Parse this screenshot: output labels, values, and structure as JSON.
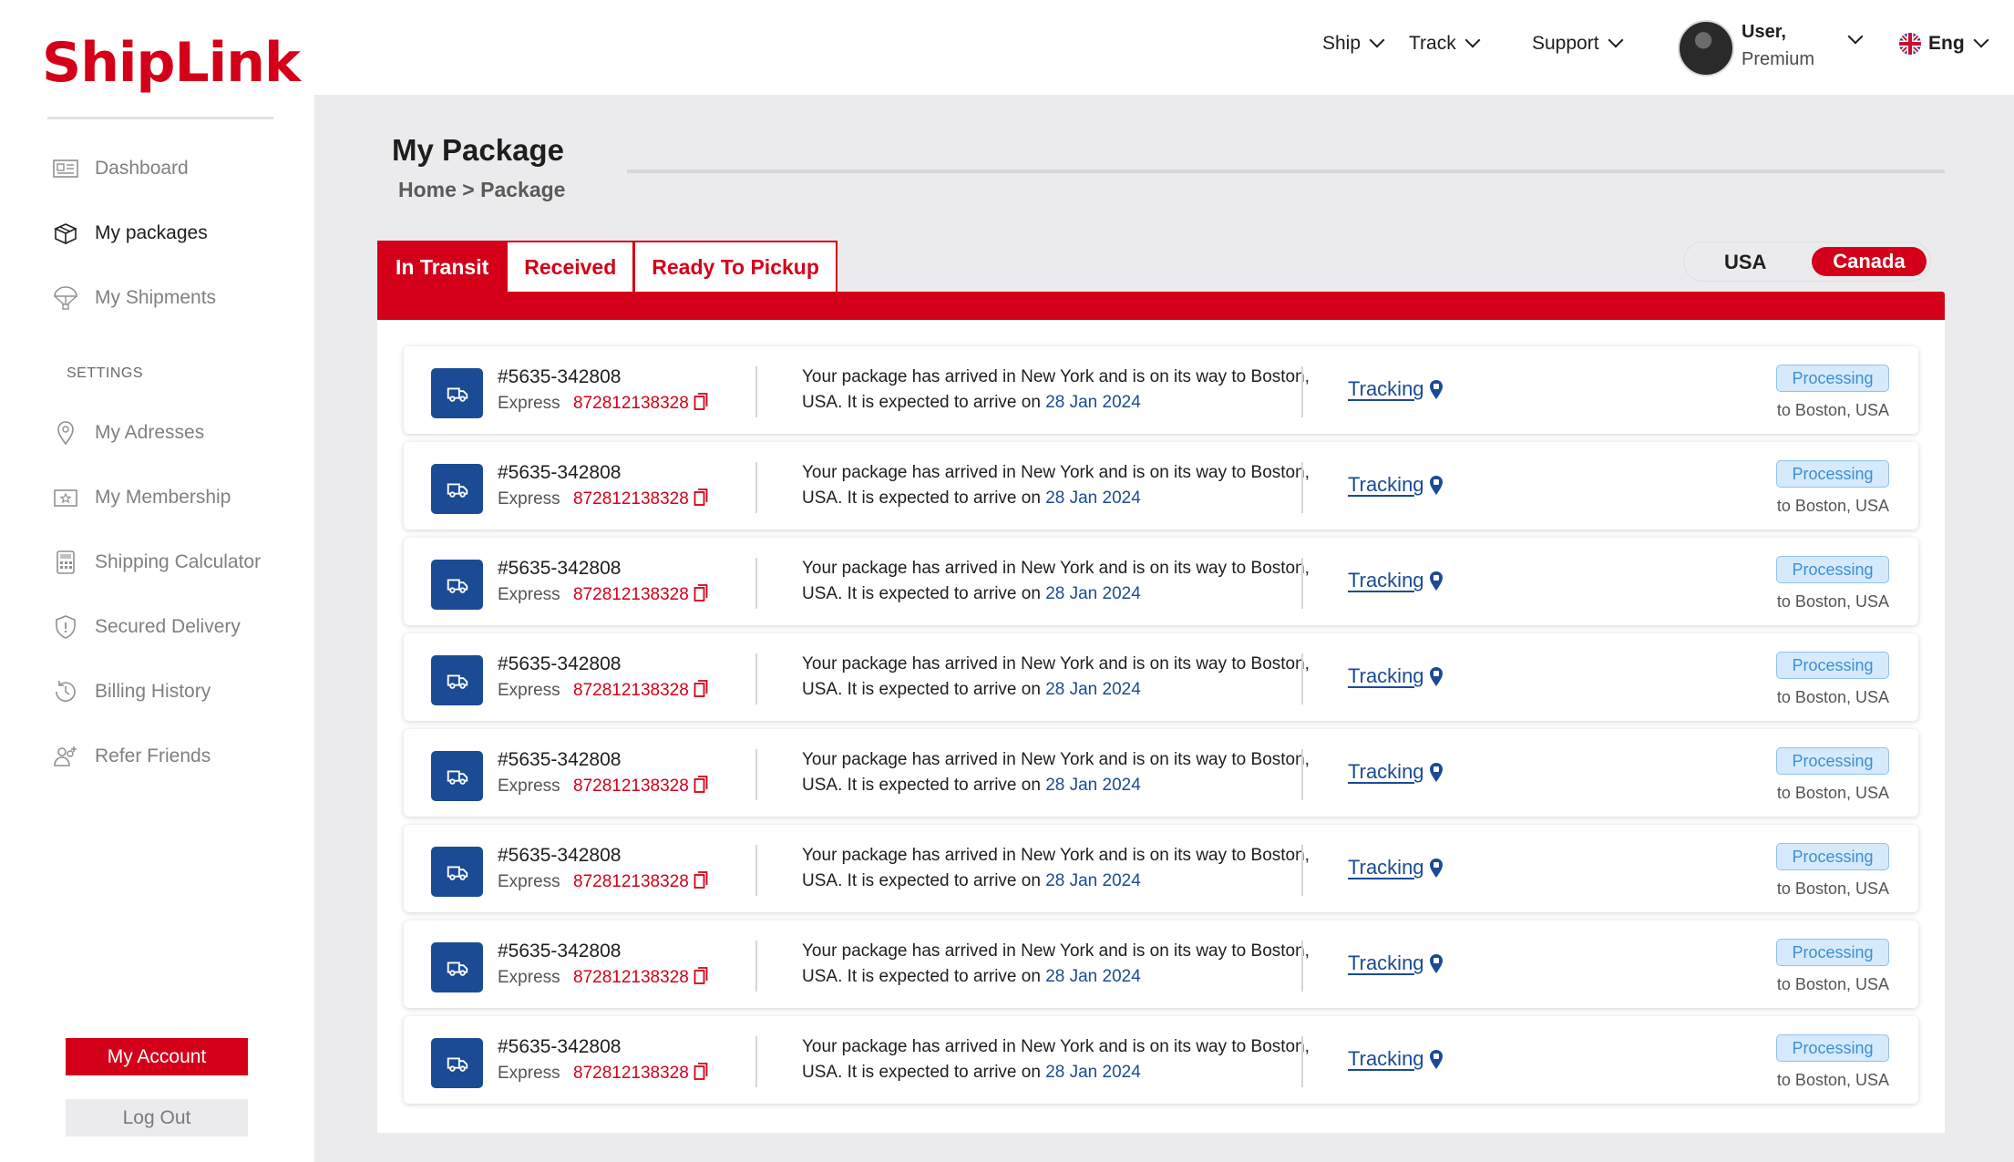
{
  "app": {
    "logo": "ShipLink"
  },
  "sidebar": {
    "items": [
      {
        "label": "Dashboard",
        "icon": "dashboard-icon",
        "active": false
      },
      {
        "label": "My packages",
        "icon": "package-icon",
        "active": true
      },
      {
        "label": "My Shipments",
        "icon": "parachute-icon",
        "active": false
      }
    ],
    "settings_label": "SETTINGS",
    "settings_items": [
      {
        "label": "My Adresses",
        "icon": "location-pin-icon"
      },
      {
        "label": "My Membership",
        "icon": "membership-card-icon"
      },
      {
        "label": "Shipping Calculator",
        "icon": "calculator-icon"
      },
      {
        "label": "Secured Delivery",
        "icon": "shield-icon"
      },
      {
        "label": "Billing History",
        "icon": "history-clock-icon"
      },
      {
        "label": "Refer Friends",
        "icon": "refer-friends-icon"
      }
    ],
    "account_button": "My Account",
    "logout_button": "Log Out"
  },
  "topbar": {
    "menus": [
      "Ship",
      "Track",
      "Support"
    ],
    "user": {
      "name": "User,",
      "tier": "Premium"
    },
    "language": "Eng"
  },
  "main": {
    "title": "My Package",
    "breadcrumb": "Home > Package",
    "tabs": [
      "In Transit",
      "Received",
      "Ready To Pickup"
    ],
    "active_tab": "In Transit",
    "regions": [
      "USA",
      "Canada"
    ],
    "active_region": "Canada",
    "rows": [
      {
        "id": "#5635-342808",
        "type": "Express",
        "number": "872812138328",
        "message": "Your package has arrived in New York and is on its way to Boston, USA. It is expected to arrive on",
        "date": "28 Jan 2024",
        "link": "Tracking",
        "status": "Processing",
        "destination": "to Boston, USA"
      },
      {
        "id": "#5635-342808",
        "type": "Express",
        "number": "872812138328",
        "message": "Your package has arrived in New York and is on its way to Boston, USA. It is expected to arrive on",
        "date": "28 Jan 2024",
        "link": "Tracking",
        "status": "Processing",
        "destination": "to Boston, USA"
      },
      {
        "id": "#5635-342808",
        "type": "Express",
        "number": "872812138328",
        "message": "Your package has arrived in New York and is on its way to Boston, USA. It is expected to arrive on",
        "date": "28 Jan 2024",
        "link": "Tracking",
        "status": "Processing",
        "destination": "to Boston, USA"
      },
      {
        "id": "#5635-342808",
        "type": "Express",
        "number": "872812138328",
        "message": "Your package has arrived in New York and is on its way to Boston, USA. It is expected to arrive on",
        "date": "28 Jan 2024",
        "link": "Tracking",
        "status": "Processing",
        "destination": "to Boston, USA"
      },
      {
        "id": "#5635-342808",
        "type": "Express",
        "number": "872812138328",
        "message": "Your package has arrived in New York and is on its way to Boston, USA. It is expected to arrive on",
        "date": "28 Jan 2024",
        "link": "Tracking",
        "status": "Processing",
        "destination": "to Boston, USA"
      },
      {
        "id": "#5635-342808",
        "type": "Express",
        "number": "872812138328",
        "message": "Your package has arrived in New York and is on its way to Boston, USA. It is expected to arrive on",
        "date": "28 Jan 2024",
        "link": "Tracking",
        "status": "Processing",
        "destination": "to Boston, USA"
      },
      {
        "id": "#5635-342808",
        "type": "Express",
        "number": "872812138328",
        "message": "Your package has arrived in New York and is on its way to Boston, USA. It is expected to arrive on",
        "date": "28 Jan 2024",
        "link": "Tracking",
        "status": "Processing",
        "destination": "to Boston, USA"
      },
      {
        "id": "#5635-342808",
        "type": "Express",
        "number": "872812138328",
        "message": "Your package has arrived in New York and is on its way to Boston, USA. It is expected to arrive on",
        "date": "28 Jan 2024",
        "link": "Tracking",
        "status": "Processing",
        "destination": "to Boston, USA"
      }
    ]
  },
  "colors": {
    "brand_red": "#d40019",
    "navy": "#1b4b94",
    "badge_bg": "#d6eafb",
    "badge_text": "#3c8fd8",
    "page_bg": "#ebebed"
  }
}
